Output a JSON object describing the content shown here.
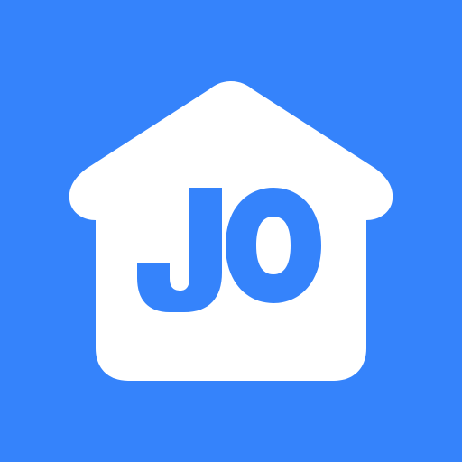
{
  "app_icon": {
    "name": "house-logo-icon",
    "logo_text": "JO",
    "colors": {
      "background": "#3583fb",
      "house": "#ffffff",
      "letters": "#3583fb"
    }
  }
}
